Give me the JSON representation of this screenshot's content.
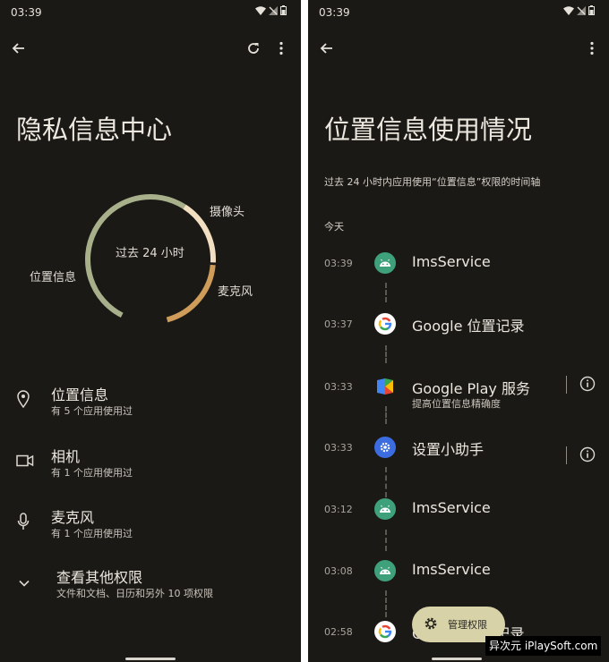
{
  "status": {
    "time": "03:39"
  },
  "left": {
    "title": "隐私信息中心",
    "donut": {
      "center_label": "过去 24 小时",
      "labels": {
        "camera": "摄像头",
        "mic": "麦克风",
        "location": "位置信息"
      },
      "colors": {
        "location": "#a7b08b",
        "camera": "#f2dec0",
        "mic": "#cf9c5a"
      }
    },
    "rows": [
      {
        "title": "位置信息",
        "sub": "有 5 个应用使用过",
        "icon": "location-pin-icon"
      },
      {
        "title": "相机",
        "sub": "有 1 个应用使用过",
        "icon": "video-camera-icon"
      },
      {
        "title": "麦克风",
        "sub": "有 1 个应用使用过",
        "icon": "microphone-icon"
      },
      {
        "title": "查看其他权限",
        "sub": "文件和文档、日历和另外 10 项权限",
        "icon": "chevron-down-icon"
      }
    ]
  },
  "right": {
    "title": "位置信息使用情况",
    "subtitle": "过去 24 小时内应用使用“位置信息”权限的时间轴",
    "day": "今天",
    "entries": [
      {
        "time": "03:39",
        "name": "ImsService",
        "sub": "",
        "icon": "android-icon"
      },
      {
        "time": "03:37",
        "name": "Google 位置记录",
        "sub": "",
        "icon": "google-icon"
      },
      {
        "time": "03:33",
        "name": "Google Play 服务",
        "sub": "提高位置信息精确度",
        "icon": "play-services-icon"
      },
      {
        "time": "03:33",
        "name": "设置小助手",
        "sub": "",
        "icon": "settings-icon"
      },
      {
        "time": "03:12",
        "name": "ImsService",
        "sub": "",
        "icon": "android-icon"
      },
      {
        "time": "03:08",
        "name": "ImsService",
        "sub": "",
        "icon": "android-icon"
      },
      {
        "time": "02:58",
        "name": "Google 位置记录",
        "sub": "",
        "icon": "google-icon"
      }
    ],
    "fab": "管理权限"
  },
  "watermark": "异次元 iPlaySoft.com"
}
